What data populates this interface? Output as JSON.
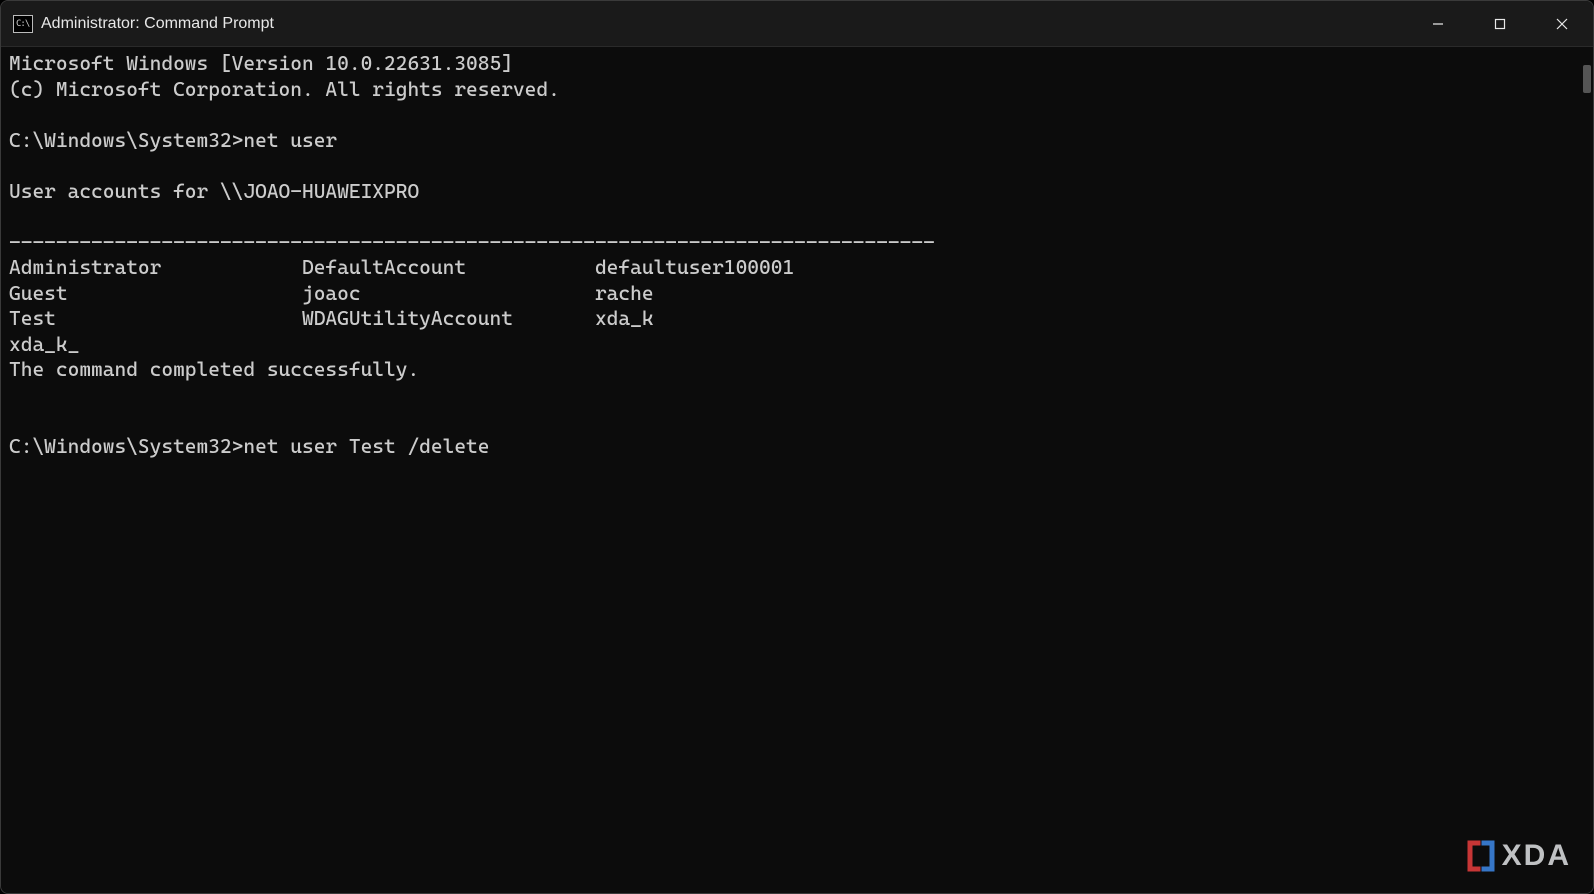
{
  "window": {
    "title": "Administrator: Command Prompt",
    "icon_label": "C:\\"
  },
  "terminal": {
    "banner_line1": "Microsoft Windows [Version 10.0.22631.3085]",
    "banner_line2": "(c) Microsoft Corporation. All rights reserved.",
    "prompt1_path": "C:\\Windows\\System32>",
    "prompt1_command": "net user",
    "accounts_header": "User accounts for \\\\JOAO-HUAWEIXPRO",
    "separator": "-------------------------------------------------------------------------------",
    "users_row1_col1": "Administrator",
    "users_row1_col2": "DefaultAccount",
    "users_row1_col3": "defaultuser100001",
    "users_row2_col1": "Guest",
    "users_row2_col2": "joaoc",
    "users_row2_col3": "rache",
    "users_row3_col1": "Test",
    "users_row3_col2": "WDAGUtilityAccount",
    "users_row3_col3": "xda_k",
    "users_row4_col1": "xda_k_",
    "success_message": "The command completed successfully.",
    "prompt2_path": "C:\\Windows\\System32>",
    "prompt2_command": "net user Test /delete"
  },
  "watermark": {
    "text": "XDA"
  }
}
